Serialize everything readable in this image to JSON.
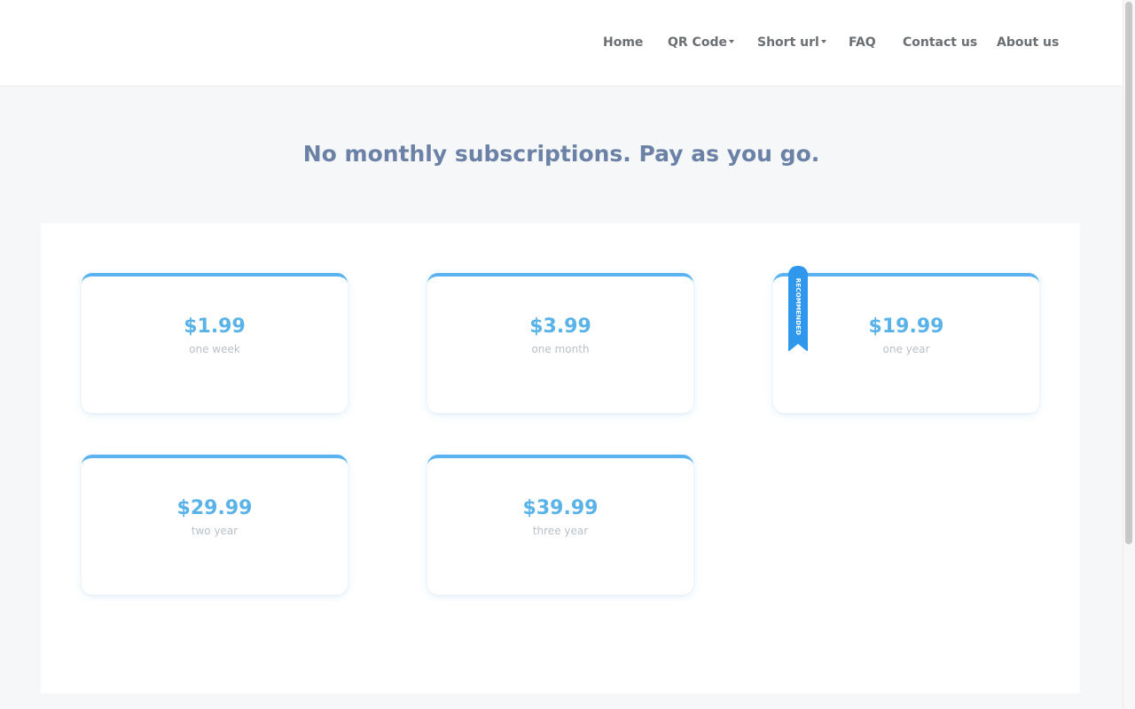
{
  "nav": {
    "home": "Home",
    "qr_code": "QR Code",
    "short_url": "Short url",
    "faq": "FAQ",
    "contact": "Contact us",
    "about": "About us"
  },
  "headline": "No monthly subscriptions. Pay as you go.",
  "plans": [
    {
      "price": "$1.99",
      "period": "one week"
    },
    {
      "price": "$3.99",
      "period": "one month"
    },
    {
      "price": "$19.99",
      "period": "one year",
      "badge": "RECOMMENDED"
    },
    {
      "price": "$29.99",
      "period": "two year"
    },
    {
      "price": "$39.99",
      "period": "three year"
    }
  ],
  "colors": {
    "accent": "#5ab3f0",
    "price": "#5ab3e8",
    "headline": "#6b82a6",
    "ribbon": "#2f97ec"
  }
}
